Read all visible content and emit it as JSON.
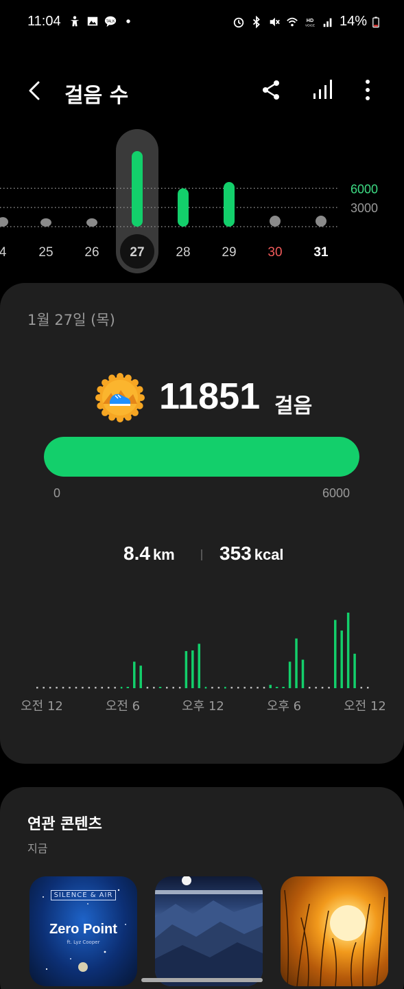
{
  "status_bar": {
    "time": "11:04",
    "battery": "14%",
    "left_icons": [
      "accessibility-icon",
      "image-icon",
      "talk-icon",
      "dot-icon"
    ],
    "right_icons": [
      "alarm-icon",
      "bluetooth-icon",
      "mute-icon",
      "wifi-icon",
      "hd-voice-icon",
      "signal-icon",
      "battery-icon"
    ]
  },
  "app_bar": {
    "title": "걸음 수"
  },
  "week": {
    "days": [
      {
        "label": "4",
        "value": 1500,
        "color": "gray",
        "selected": false
      },
      {
        "label": "25",
        "value": 1300,
        "color": "gray",
        "selected": false
      },
      {
        "label": "26",
        "value": 1300,
        "color": "gray",
        "selected": false
      },
      {
        "label": "27",
        "value": 11851,
        "color": "green",
        "selected": true
      },
      {
        "label": "28",
        "value": 6000,
        "color": "green",
        "selected": false
      },
      {
        "label": "29",
        "value": 7000,
        "color": "green",
        "selected": false
      },
      {
        "label": "30",
        "value": 0,
        "color": "gray",
        "selected": false,
        "label_color": "#f05a5a"
      },
      {
        "label": "31",
        "value": 0,
        "color": "gray",
        "selected": false,
        "label_color": "#ffffff",
        "bold": true
      }
    ],
    "ref_lines": [
      {
        "value": 6000,
        "label": "6000",
        "color": "#3ddc84"
      },
      {
        "value": 3000,
        "label": "3000",
        "color": "#9a9a9a"
      }
    ],
    "colors": {
      "green": "#13cf6b",
      "gray": "#8a8a8a",
      "selected_bg": "#3a3a3a"
    }
  },
  "summary": {
    "date": "1월 27일 (목)",
    "steps": "11851",
    "steps_unit": "걸음",
    "goal_min": "0",
    "goal_max": "6000",
    "progress_fraction": 1.0,
    "distance_value": "8.4",
    "distance_unit": "km",
    "calories_value": "353",
    "calories_unit": "kcal"
  },
  "chart_data": {
    "type": "bar",
    "title": "",
    "x_tick_labels": [
      "오전 12",
      "오전 6",
      "오후 12",
      "오후 6",
      "오전 12"
    ],
    "bar_count": 48,
    "values": [
      0,
      0,
      0,
      0,
      0,
      0,
      0,
      0,
      0,
      0,
      0,
      0,
      0,
      1,
      2,
      40,
      34,
      0,
      0,
      2,
      0,
      0,
      0,
      56,
      57,
      67,
      1,
      0,
      0,
      1,
      0,
      0,
      0,
      0,
      0,
      0,
      5,
      2,
      2,
      40,
      75,
      43,
      0,
      0,
      0,
      0,
      103,
      87,
      114,
      52,
      0,
      0
    ],
    "color": "#13cf6b",
    "baseline_dot_color": "#bdbdbd"
  },
  "related": {
    "title": "연관 콘텐츠",
    "subtitle": "지금",
    "items": [
      {
        "brand": "SILENCE & AIR",
        "title": "Zero Point",
        "subtitle": "ft. Lyz Cooper"
      },
      {
        "name": "mountain-night"
      },
      {
        "name": "sunset"
      }
    ]
  }
}
